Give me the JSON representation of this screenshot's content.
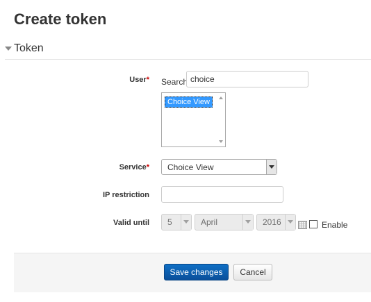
{
  "page": {
    "title": "Create token"
  },
  "section": {
    "title": "Token"
  },
  "form": {
    "user": {
      "label": "User",
      "required_mark": "*",
      "search_label": "Search",
      "search_value": "choice",
      "options": [
        "Choice View"
      ]
    },
    "service": {
      "label": "Service",
      "required_mark": "*",
      "selected": "Choice View"
    },
    "ip_restriction": {
      "label": "IP restriction",
      "value": ""
    },
    "valid_until": {
      "label": "Valid until",
      "day": "5",
      "month": "April",
      "year": "2016",
      "enable_label": "Enable",
      "enabled": false
    }
  },
  "buttons": {
    "save": "Save changes",
    "cancel": "Cancel"
  },
  "colors": {
    "primary_button": "#0f6fc5",
    "required": "#cc0000",
    "selection": "#3399ff"
  }
}
